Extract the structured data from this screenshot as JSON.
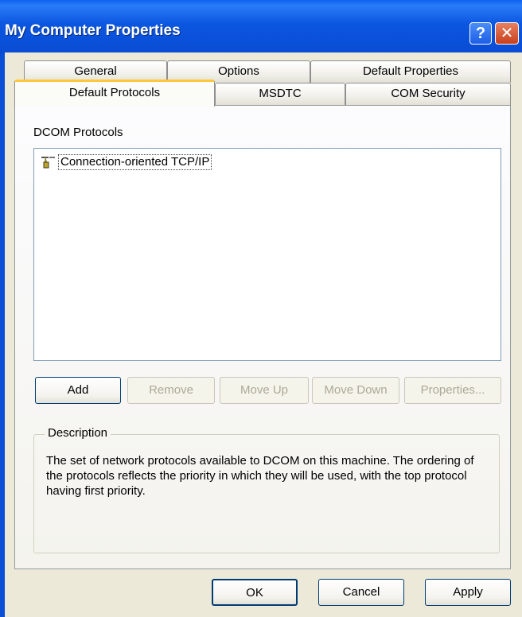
{
  "window": {
    "title": "My Computer Properties",
    "help_glyph": "?",
    "close_glyph": "✕"
  },
  "tabs": {
    "row_back": [
      "General",
      "Options",
      "Default Properties"
    ],
    "row_front": [
      "Default Protocols",
      "MSDTC",
      "COM Security"
    ],
    "active": "Default Protocols"
  },
  "protocols": {
    "label": "DCOM Protocols",
    "items": [
      {
        "label": "Connection-oriented TCP/IP",
        "icon": "network-protocol-icon"
      }
    ]
  },
  "buttons": {
    "add": "Add",
    "remove": "Remove",
    "move_up": "Move Up",
    "move_down": "Move Down",
    "properties": "Properties..."
  },
  "description": {
    "title": "Description",
    "text": "The set of network protocols available to DCOM on this machine. The ordering of the protocols reflects the priority in which they will be used, with the top protocol having first priority."
  },
  "footer": {
    "ok": "OK",
    "cancel": "Cancel",
    "apply": "Apply"
  }
}
